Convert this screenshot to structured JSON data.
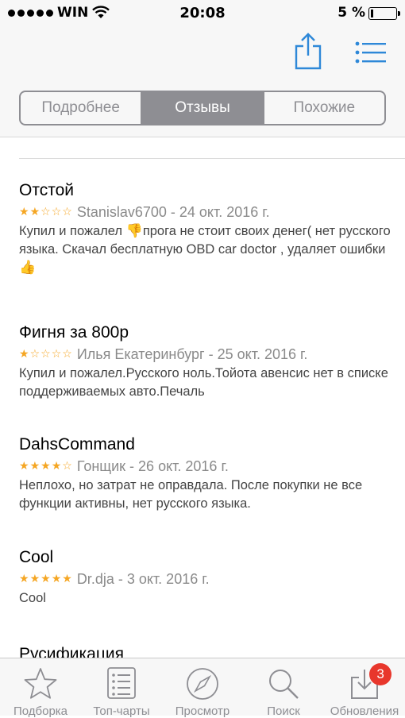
{
  "status_bar": {
    "carrier": "WIN",
    "time": "20:08",
    "battery_percent": "5 %"
  },
  "nav": {
    "share_icon": "share-icon",
    "list_icon": "list-icon"
  },
  "segments": [
    {
      "label": "Подробнее",
      "active": false
    },
    {
      "label": "Отзывы",
      "active": true
    },
    {
      "label": "Похожие",
      "active": false
    }
  ],
  "reviews": [
    {
      "title": "Отстой",
      "rating": 2,
      "author_date": "Stanislav6700 - 24 окт. 2016 г.",
      "body_1": "Купил и пожалел ",
      "emoji_1": "👎",
      "body_2": "прога не стоит своих денег( нет русского языка. Скачал бесплатную OBD car doctor , удаляет ошибки",
      "emoji_2": "👍"
    },
    {
      "title": "Фигня за 800р",
      "rating": 1,
      "author_date": "Илья Екатеринбург - 25 окт. 2016 г.",
      "body": "Купил и пожалел.Русского ноль.Тойота авенсис нет в списке поддерживаемых авто.Печаль"
    },
    {
      "title": "DahsCommand",
      "rating": 4,
      "author_date": "Гонщик - 26 окт. 2016 г.",
      "body": "Неплохо, но затрат не оправдала. После покупки не все функции активны, нет русского языка."
    },
    {
      "title": "Cool",
      "rating": 5,
      "author_date": "Dr.dja - 3 окт. 2016 г.",
      "body": "Cool"
    },
    {
      "title": "Русификация"
    }
  ],
  "tabs": [
    {
      "label": "Подборка",
      "icon": "star-icon"
    },
    {
      "label": "Топ-чарты",
      "icon": "list-icon"
    },
    {
      "label": "Просмотр",
      "icon": "compass-icon"
    },
    {
      "label": "Поиск",
      "icon": "search-icon"
    },
    {
      "label": "Обновления",
      "icon": "download-icon",
      "badge": "3"
    }
  ],
  "colors": {
    "accent": "#3d8fd6",
    "star": "#f5a623",
    "badge": "#e8372c",
    "segment": "#8e8e93"
  }
}
